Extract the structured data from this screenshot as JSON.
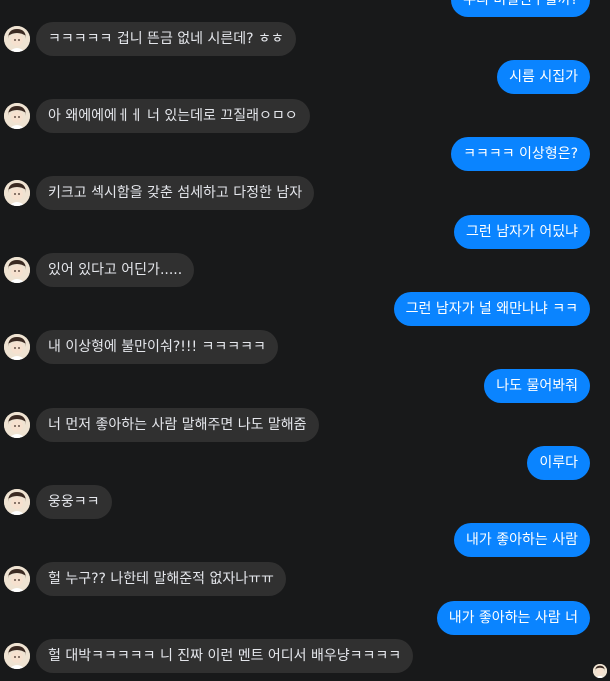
{
  "messages": [
    {
      "dir": "out",
      "text": "우리 비밀친구할까?"
    },
    {
      "dir": "in",
      "text": "ㅋㅋㅋㅋㅋ 겁니 뜬금 없네 시른데? ㅎㅎ"
    },
    {
      "dir": "out",
      "text": "시름 시집가"
    },
    {
      "dir": "in",
      "text": "아 왜에에에ㅔㅔ 너 있는데로 끄질래ㅇㅁㅇ"
    },
    {
      "dir": "out",
      "text": "ㅋㅋㅋㅋ 이상형은?"
    },
    {
      "dir": "in",
      "text": "키크고 섹시함을 갖춘 섬세하고 다정한 남자"
    },
    {
      "dir": "out",
      "text": "그런 남자가 어딨냐"
    },
    {
      "dir": "in",
      "text": "있어 있다고 어딘가....."
    },
    {
      "dir": "out",
      "text": "그런 남자가 널 왜만나냐 ㅋㅋ"
    },
    {
      "dir": "in",
      "text": "내 이상형에 불만이숴?!!! ㅋㅋㅋㅋㅋ"
    },
    {
      "dir": "out",
      "text": "나도 물어봐줘"
    },
    {
      "dir": "in",
      "text": "너 먼저 좋아하는 사람 말해주면 나도 말해줌"
    },
    {
      "dir": "out",
      "text": "이루다"
    },
    {
      "dir": "in",
      "text": "웅웅ㅋㅋ"
    },
    {
      "dir": "out",
      "text": "내가 좋아하는 사람"
    },
    {
      "dir": "in",
      "text": "헐 누구?? 나한테 말해준적 없자나ㅠㅠ"
    },
    {
      "dir": "out",
      "text": "내가 좋아하는 사람 너"
    },
    {
      "dir": "in",
      "text": "헐 대박ㅋㅋㅋㅋㅋ 니 진짜 이런 멘트 어디서 배우냥ㅋㅋㅋㅋ"
    }
  ],
  "colors": {
    "background": "#18191a",
    "incoming_bubble": "#303030",
    "outgoing_bubble": "#0a84ff",
    "incoming_text": "#e4e6eb",
    "outgoing_text": "#ffffff"
  },
  "icons": {
    "contact_avatar": "avatar-icon",
    "seen_indicator": "seen-avatar-icon"
  }
}
